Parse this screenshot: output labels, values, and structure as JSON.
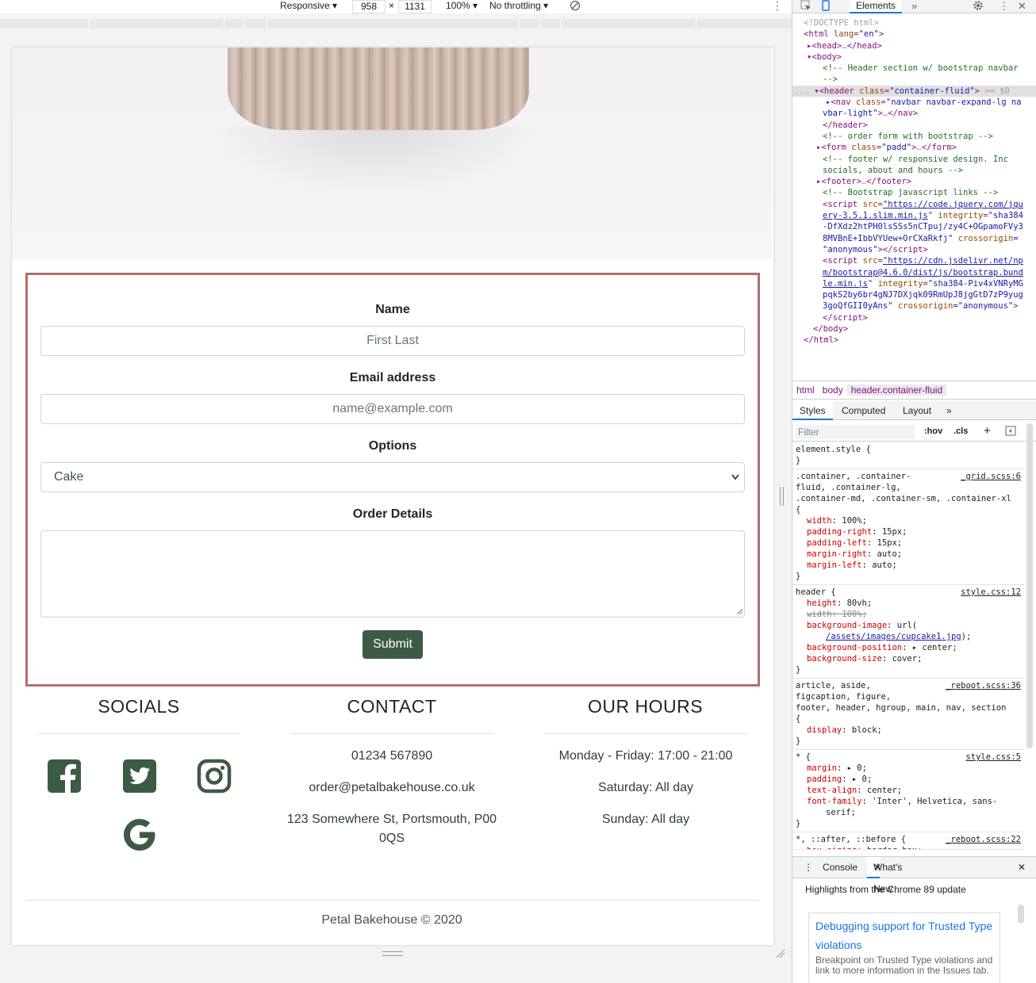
{
  "device_toolbar": {
    "mode": "Responsive",
    "width": "958",
    "times": "×",
    "height": "1131",
    "zoom": "100%",
    "throttling": "No throttling"
  },
  "site": {
    "form": {
      "name_label": "Name",
      "name_placeholder": "First Last",
      "email_label": "Email address",
      "email_placeholder": "name@example.com",
      "options_label": "Options",
      "options_selected": "Cake",
      "details_label": "Order Details",
      "submit_label": "Submit"
    },
    "footer": {
      "socials_heading": "SOCIALS",
      "socials_icons": [
        "facebook-icon",
        "twitter-icon",
        "instagram-icon",
        "google-icon"
      ],
      "contact_heading": "CONTACT",
      "phone": "01234 567890",
      "email": "order@petalbakehouse.co.uk",
      "address_line1": "123 Somewhere St, Portsmouth, P00",
      "address_line2": "0QS",
      "hours_heading": "OUR HOURS",
      "hours_weekday": "Monday - Friday: 17:00 - 21:00",
      "hours_saturday": "Saturday: All day",
      "hours_sunday": "Sunday: All day",
      "copyright": "Petal Bakehouse © 2020"
    },
    "colors": {
      "accent_green": "#3d5a45",
      "form_border": "#b26e6e"
    }
  },
  "devtools": {
    "active_tab": "Elements",
    "breadcrumbs": [
      "html",
      "body",
      "header.container-fluid"
    ],
    "style_tabs": [
      "Styles",
      "Computed",
      "Layout"
    ],
    "filter_placeholder": "Filter",
    "hov": ":hov",
    "cls": ".cls",
    "drawer_tabs": [
      "Console",
      "What's New"
    ],
    "highlights": "Highlights from the Chrome 89 update",
    "card_title": "Debugging support for Trusted Type violations",
    "card_body": "Breakpoint on Trusted Type violations and link to more information in the Issues tab."
  }
}
